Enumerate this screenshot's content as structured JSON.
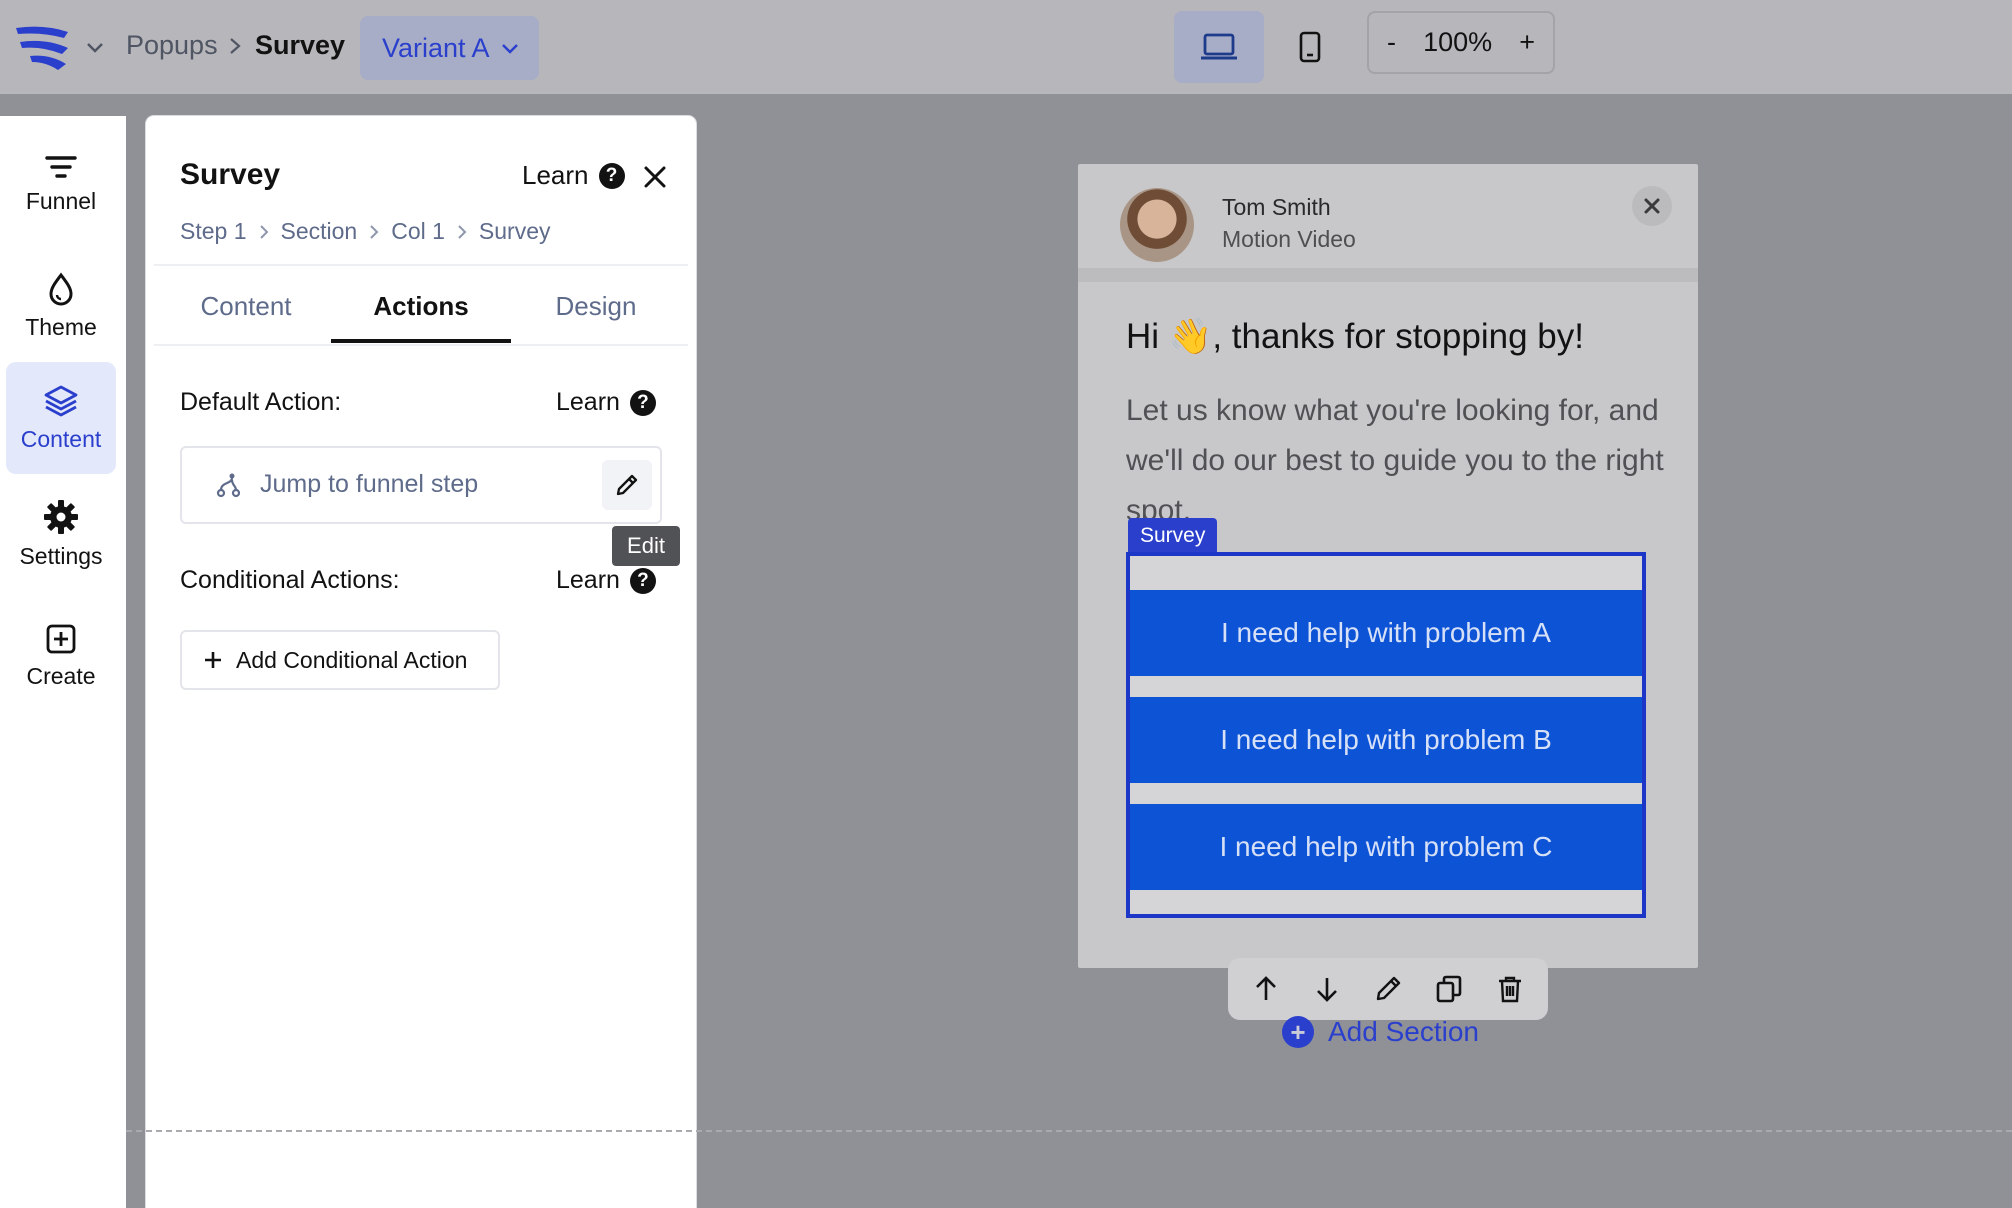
{
  "topbar": {
    "breadcrumb_root": "Popups",
    "breadcrumb_current": "Survey",
    "variant_label": "Variant A",
    "zoom_minus": "-",
    "zoom_value": "100%",
    "zoom_plus": "+"
  },
  "rail": {
    "items": [
      {
        "label": "Funnel",
        "icon": "funnel-icon"
      },
      {
        "label": "Theme",
        "icon": "droplet-icon"
      },
      {
        "label": "Content",
        "icon": "layers-icon"
      },
      {
        "label": "Settings",
        "icon": "gear-icon"
      },
      {
        "label": "Create",
        "icon": "plus-square-icon"
      }
    ],
    "active": "Content"
  },
  "panel": {
    "title": "Survey",
    "learn": "Learn",
    "breadcrumb": [
      "Step 1",
      "Section",
      "Col 1",
      "Survey"
    ],
    "tabs": [
      "Content",
      "Actions",
      "Design"
    ],
    "active_tab": "Actions",
    "default_action_label": "Default Action:",
    "default_action_learn": "Learn",
    "default_action_value": "Jump to funnel step",
    "edit_tooltip": "Edit",
    "conditional_label": "Conditional Actions:",
    "conditional_learn": "Learn",
    "add_conditional": "Add Conditional Action"
  },
  "popup": {
    "author_name": "Tom Smith",
    "author_role": "Motion Video",
    "heading": "Hi 👋, thanks for stopping by!",
    "body": "Let us know what you're looking for, and we'll do our best to guide you to the right spot.",
    "survey_tag": "Survey",
    "options": [
      "I need help with problem A",
      "I need help with problem B",
      "I need help with problem C"
    ]
  },
  "canvas": {
    "add_section": "Add Section"
  },
  "colors": {
    "accent": "#2b3fcd",
    "survey_option": "#0d53d6"
  }
}
